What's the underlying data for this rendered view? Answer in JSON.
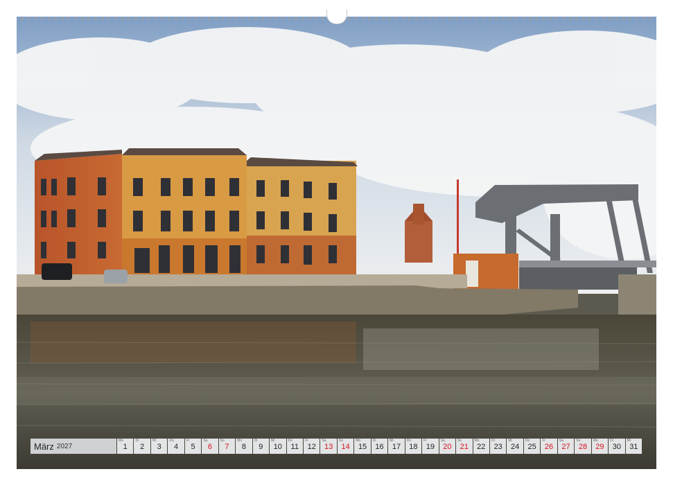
{
  "calendar": {
    "month": "März",
    "year": "2027",
    "days": [
      {
        "dn": "Mo",
        "num": "1",
        "red": false
      },
      {
        "dn": "Di",
        "num": "2",
        "red": false
      },
      {
        "dn": "Mi",
        "num": "3",
        "red": false
      },
      {
        "dn": "Do",
        "num": "4",
        "red": false
      },
      {
        "dn": "Fr",
        "num": "5",
        "red": false
      },
      {
        "dn": "Sa",
        "num": "6",
        "red": true
      },
      {
        "dn": "So",
        "num": "7",
        "red": true
      },
      {
        "dn": "Mo",
        "num": "8",
        "red": false
      },
      {
        "dn": "Di",
        "num": "9",
        "red": false
      },
      {
        "dn": "Mi",
        "num": "10",
        "red": false
      },
      {
        "dn": "Do",
        "num": "11",
        "red": false
      },
      {
        "dn": "Fr",
        "num": "12",
        "red": false
      },
      {
        "dn": "Sa",
        "num": "13",
        "red": true
      },
      {
        "dn": "So",
        "num": "14",
        "red": true
      },
      {
        "dn": "Mo",
        "num": "15",
        "red": false
      },
      {
        "dn": "Di",
        "num": "16",
        "red": false
      },
      {
        "dn": "Mi",
        "num": "17",
        "red": false
      },
      {
        "dn": "Do",
        "num": "18",
        "red": false
      },
      {
        "dn": "Fr",
        "num": "19",
        "red": false
      },
      {
        "dn": "Sa",
        "num": "20",
        "red": true
      },
      {
        "dn": "So",
        "num": "21",
        "red": true
      },
      {
        "dn": "Mo",
        "num": "22",
        "red": false
      },
      {
        "dn": "Di",
        "num": "23",
        "red": false
      },
      {
        "dn": "Mi",
        "num": "24",
        "red": false
      },
      {
        "dn": "Do",
        "num": "25",
        "red": false
      },
      {
        "dn": "Fr",
        "num": "26",
        "red": true
      },
      {
        "dn": "Sa",
        "num": "27",
        "red": true
      },
      {
        "dn": "So",
        "num": "28",
        "red": true
      },
      {
        "dn": "Mo",
        "num": "29",
        "red": true
      },
      {
        "dn": "Di",
        "num": "30",
        "red": false
      },
      {
        "dn": "Mi",
        "num": "31",
        "red": false
      }
    ]
  },
  "colors": {
    "weekend_red": "#d4141b",
    "month_label_bg": "#cfd1d3",
    "day_cell_bg": "#e3e4e6"
  },
  "icons": [
    "binding-rings",
    "calendar-hanger"
  ]
}
